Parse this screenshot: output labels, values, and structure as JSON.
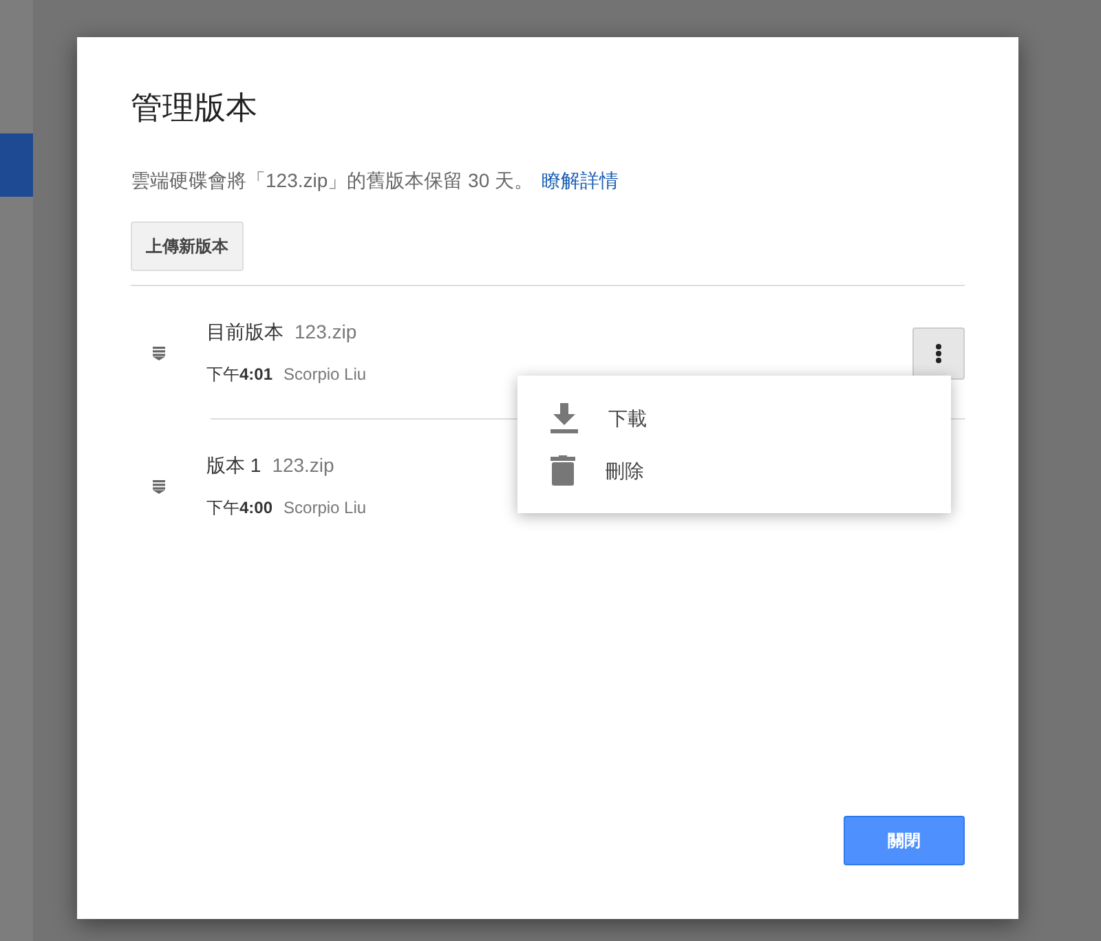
{
  "dialog": {
    "title": "管理版本",
    "notice": "雲端硬碟會將「123.zip」的舊版本保留 30 天。",
    "notice_link": "瞭解詳情",
    "upload_button": "上傳新版本",
    "versions": [
      {
        "label": "目前版本",
        "file": "123.zip",
        "time": "下午**4:01**",
        "author": "Scorpio Liu",
        "menu_open": true
      },
      {
        "label": "版本 1",
        "file": "123.zip",
        "time": "下午**4:00**",
        "author": "Scorpio Liu",
        "menu_open": false
      }
    ],
    "menu": [
      {
        "kind": "download",
        "label": "下載"
      },
      {
        "kind": "delete",
        "label": "刪除"
      }
    ],
    "close_button": "關閉"
  }
}
